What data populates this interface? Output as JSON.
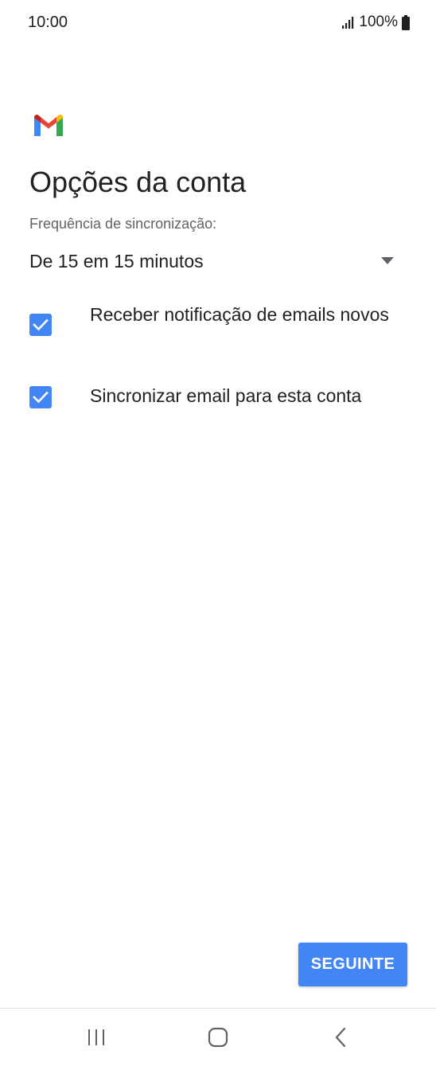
{
  "status_bar": {
    "time": "10:00",
    "battery": "100%",
    "icons": [
      "signal-icon",
      "battery-icon"
    ]
  },
  "app": {
    "logo": "gmail-logo-icon"
  },
  "page": {
    "title": "Opções da conta"
  },
  "sync": {
    "label": "Frequência de sincronização:",
    "selected": "De 15 em 15 minutos"
  },
  "options": [
    {
      "label": "Receber notificação de emails novos",
      "checked": true
    },
    {
      "label": "Sincronizar email para esta conta",
      "checked": true
    }
  ],
  "actions": {
    "next_label": "SEGUINTE"
  },
  "navigation": {
    "icons": [
      "recents-icon",
      "home-icon",
      "back-icon"
    ]
  },
  "colors": {
    "accent": "#4285f4",
    "text": "#202124",
    "secondary_text": "#5f6368"
  }
}
